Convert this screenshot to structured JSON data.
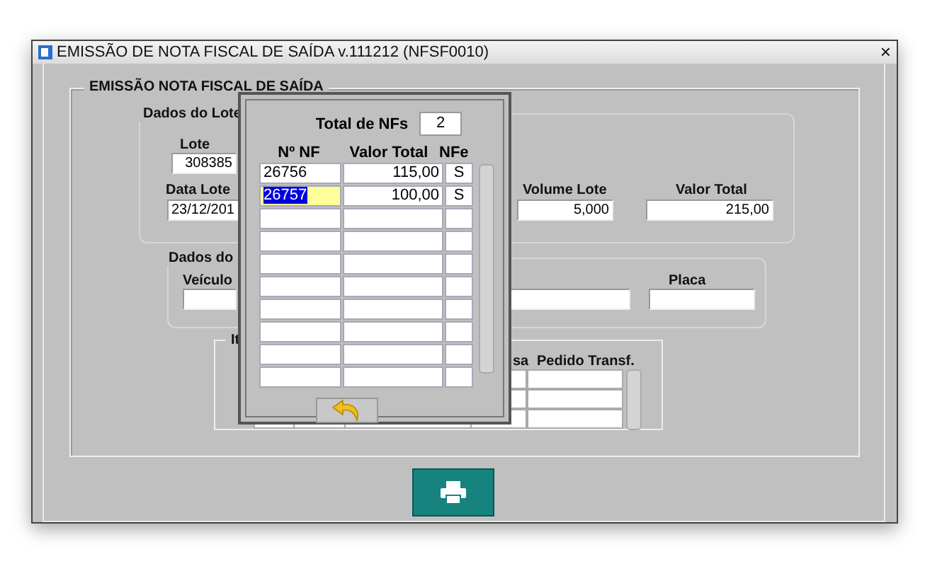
{
  "window": {
    "title": "EMISSÃO DE NOTA FISCAL DE SAÍDA v.111212 (NFSF0010)",
    "close": "×"
  },
  "main_frame": {
    "title": "EMISSÃO NOTA FISCAL DE SAÍDA"
  },
  "lote_group": {
    "title": "Dados do Lote",
    "fields": [
      {
        "label": "Lote",
        "value": "308385"
      },
      {
        "label": "Data Lote",
        "value": "23/12/201"
      },
      {
        "label": "Volume Lote",
        "value": "5,000"
      },
      {
        "label": "Valor Total",
        "value": "215,00"
      }
    ]
  },
  "transport_group": {
    "title": "Dados do",
    "fields": [
      {
        "label": "Veículo"
      },
      {
        "label": "Placa"
      }
    ]
  },
  "items_group": {
    "title": "It",
    "columns": [
      "sa",
      "Pedido Transf."
    ]
  },
  "dialog": {
    "total_label": "Total de NFs",
    "total_value": "2",
    "columns": [
      "Nº NF",
      "Valor Total",
      "NFe"
    ],
    "rows": [
      {
        "nf": "26756",
        "valor": "115,00",
        "nfe": "S",
        "current": false,
        "text_selected": false
      },
      {
        "nf": "26757",
        "valor": "100,00",
        "nfe": "S",
        "current": true,
        "text_selected": true
      }
    ]
  }
}
